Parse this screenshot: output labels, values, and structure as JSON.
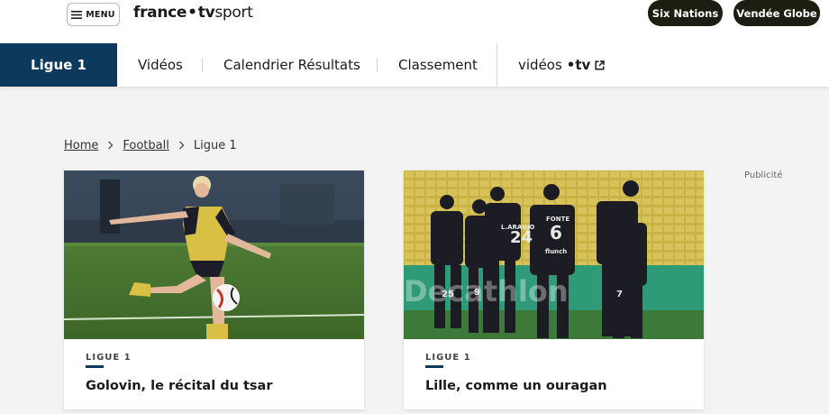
{
  "header": {
    "menu_label": "MENU",
    "brand": {
      "part1": "france",
      "dot": "•",
      "part2": "tv",
      "part3": "sport"
    },
    "pills": [
      "Six Nations",
      "Vendée Globe"
    ],
    "colors": {
      "pill_bg": "#1e1d12",
      "accent": "#0d3a5c"
    }
  },
  "nav": {
    "active": "Ligue 1",
    "items": [
      "Vidéos",
      "Calendrier Résultats",
      "Classement"
    ],
    "external": {
      "label": "vidéos",
      "logo": "•tv",
      "icon": "external-link-icon"
    }
  },
  "breadcrumb": {
    "items": [
      "Home",
      "Football",
      "Ligue 1"
    ],
    "separator_icon": "chevron-right-icon"
  },
  "cards": [
    {
      "tag": "LIGUE 1",
      "title": "Golovin, le récital du tsar"
    },
    {
      "tag": "LIGUE 1",
      "title": "Lille, comme un ouragan"
    }
  ],
  "ad_label": "Publicité"
}
